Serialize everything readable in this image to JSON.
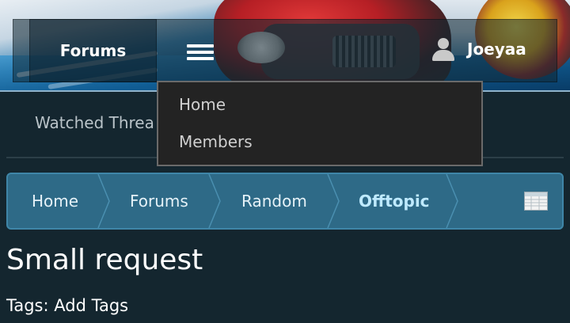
{
  "header": {
    "forums_label": "Forums",
    "menu_icon": "hamburger-menu-icon",
    "user": {
      "icon": "user-icon",
      "name": "Joeyaa"
    }
  },
  "subtabs": {
    "watched_label": "Watched Threa"
  },
  "dropdown": {
    "items": [
      {
        "label": "Home"
      },
      {
        "label": "Members"
      }
    ]
  },
  "breadcrumb": {
    "items": [
      {
        "label": "Home"
      },
      {
        "label": "Forums"
      },
      {
        "label": "Random"
      },
      {
        "label": "Offtopic",
        "current": true
      }
    ],
    "list_icon": "jump-list-icon"
  },
  "thread": {
    "title": "Small request",
    "tags_prefix": "Tags:",
    "add_tags_label": "Add Tags"
  },
  "colors": {
    "page_bg": "#14262f",
    "breadcrumb_bg": "#2e6a87",
    "breadcrumb_current": "#bfeaff",
    "dropdown_bg": "#232323"
  }
}
